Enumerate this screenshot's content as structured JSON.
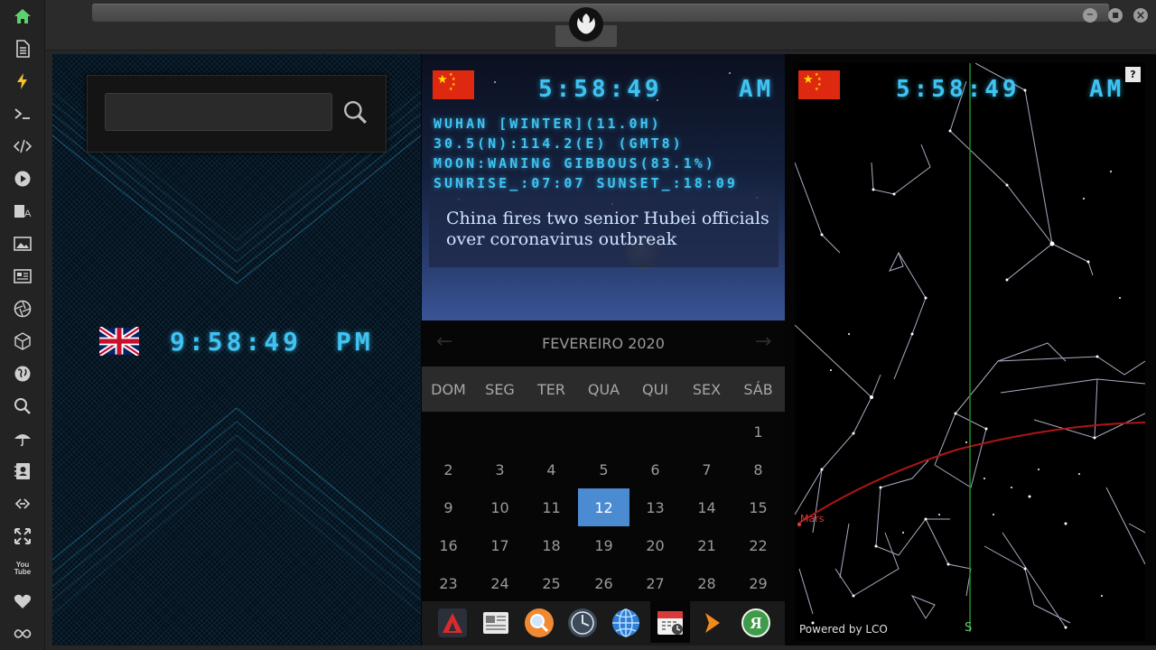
{
  "sidebar": {
    "items": [
      {
        "icon": "home-icon"
      },
      {
        "icon": "document-icon"
      },
      {
        "icon": "lightning-icon"
      },
      {
        "icon": "terminal-icon"
      },
      {
        "icon": "code-icon"
      },
      {
        "icon": "play-icon"
      },
      {
        "icon": "translate-icon"
      },
      {
        "icon": "image-icon"
      },
      {
        "icon": "news-icon"
      },
      {
        "icon": "aperture-icon"
      },
      {
        "icon": "cube-icon"
      },
      {
        "icon": "globe-icon"
      },
      {
        "icon": "search-icon"
      },
      {
        "icon": "umbrella-icon"
      },
      {
        "icon": "contacts-icon"
      },
      {
        "icon": "link-icon"
      },
      {
        "icon": "fullscreen-icon"
      },
      {
        "icon": "youtube-icon"
      },
      {
        "icon": "heart-icon"
      },
      {
        "icon": "infinity-icon"
      }
    ],
    "youtube_label": "You Tube",
    "colors": {
      "active": "#5fd06b",
      "default": "#cfcfcf"
    }
  },
  "window": {
    "minimize_label": "−",
    "maximize_label": "■",
    "close_label": "×"
  },
  "left_panel": {
    "search": {
      "value": "",
      "placeholder": ""
    },
    "uk_clock": {
      "time": "9:58:49",
      "ampm": "PM"
    }
  },
  "middle_panel": {
    "clock": {
      "time": "5:58:49",
      "ampm": "AM"
    },
    "info": [
      "WUHAN [WINTER](11.0H)",
      "30.5(N):114.2(E) (GMT8)",
      "MOON:WANING GIBBOUS(83.1%)",
      "SUNRISE_:07:07 SUNSET_:18:09"
    ],
    "news": "China fires two senior Hubei officials over coronavirus outbreak"
  },
  "calendar": {
    "month_label": "FEVEREIRO 2020",
    "prev_label": "←",
    "next_label": "→",
    "weekdays": [
      "DOM",
      "SEG",
      "TER",
      "QUA",
      "QUI",
      "SEX",
      "SÁB"
    ],
    "weeks": [
      [
        "",
        "",
        "",
        "",
        "",
        "",
        "1"
      ],
      [
        "2",
        "3",
        "4",
        "5",
        "6",
        "7",
        "8"
      ],
      [
        "9",
        "10",
        "11",
        "12",
        "13",
        "14",
        "15"
      ],
      [
        "16",
        "17",
        "18",
        "19",
        "20",
        "21",
        "22"
      ],
      [
        "23",
        "24",
        "25",
        "26",
        "27",
        "28",
        "29"
      ]
    ],
    "today": "12",
    "today_color": "#4a8bd1"
  },
  "dock": {
    "items": [
      {
        "icon": "red-triangle-app-icon"
      },
      {
        "icon": "news-reader-icon"
      },
      {
        "icon": "magnifier-app-icon"
      },
      {
        "icon": "clock-app-icon"
      },
      {
        "icon": "globe-app-icon"
      },
      {
        "icon": "calendar-app-icon"
      },
      {
        "icon": "arrow-app-icon"
      },
      {
        "icon": "yandex-app-icon"
      }
    ],
    "yandex_letter": "Я"
  },
  "right_panel": {
    "clock": {
      "time": "5:58:49",
      "ampm": "AM"
    },
    "help_label": "?",
    "planet_label": "Mars",
    "direction_label": "S",
    "powered_by": "Powered by LCO"
  },
  "colors": {
    "digital": "#3fc3f2",
    "ecliptic": "#b01515",
    "meridian": "#1f8f2a",
    "china_red": "#de2910",
    "china_yellow": "#ffde00"
  }
}
